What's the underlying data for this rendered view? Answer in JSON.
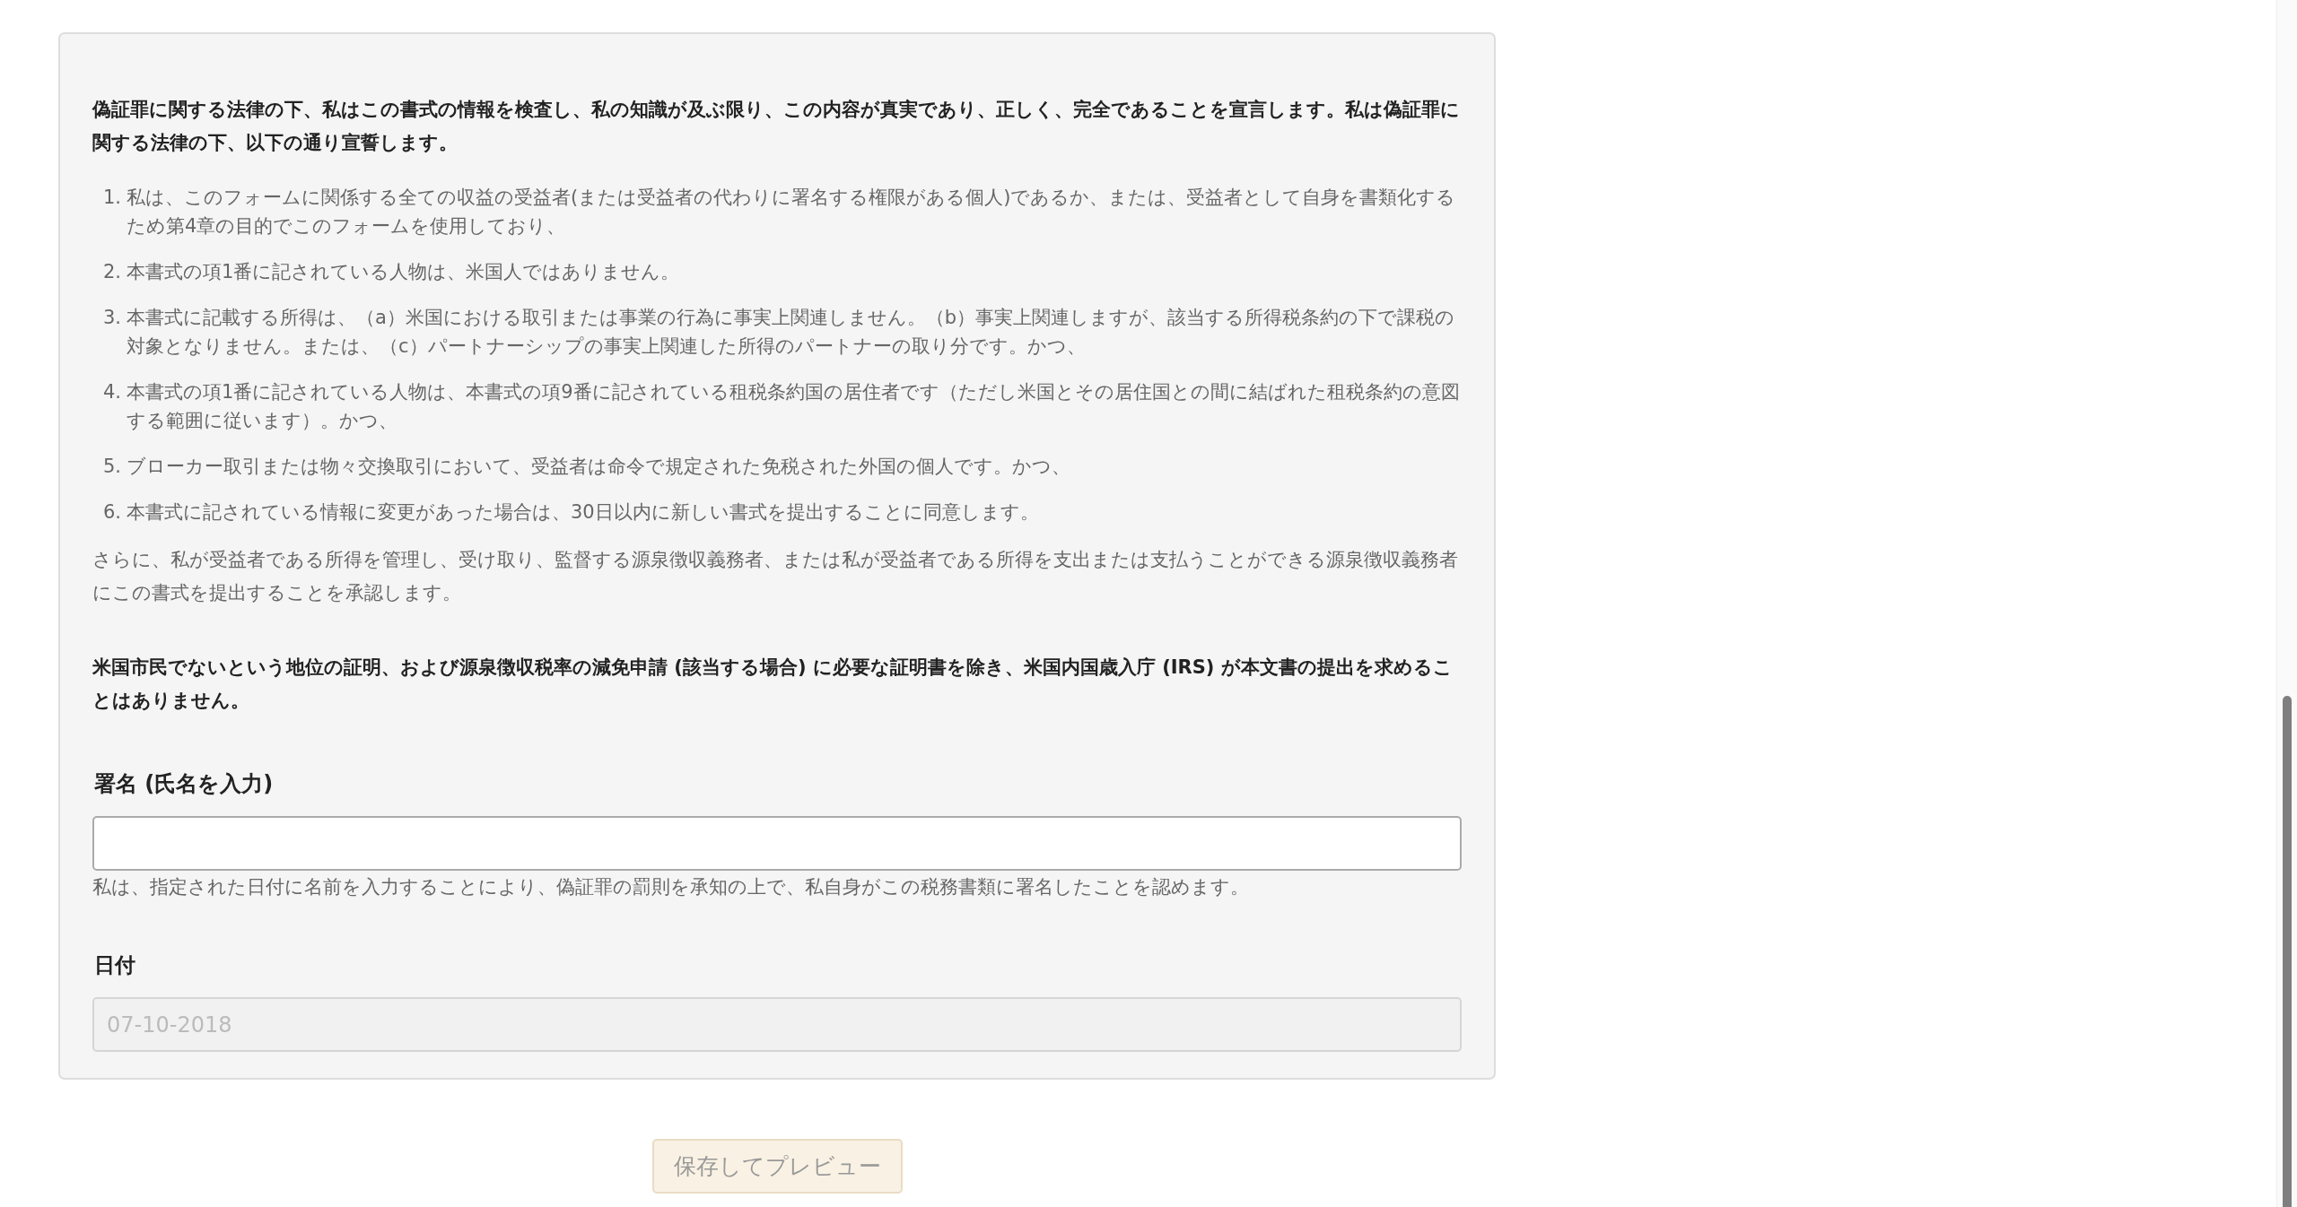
{
  "declaration": {
    "intro": "偽証罪に関する法律の下、私はこの書式の情報を検査し、私の知識が及ぶ限り、この内容が真実であり、正しく、完全であることを宣言します。私は偽証罪に関する法律の下、以下の通り宣誓します。",
    "items": [
      {
        "number": "1.",
        "text": "私は、このフォームに関係する全ての収益の受益者(または受益者の代わりに署名する権限がある個人)であるか、または、受益者として自身を書類化するため第4章の目的でこのフォームを使用しており、"
      },
      {
        "number": "2.",
        "text": "本書式の項1番に記されている人物は、米国人ではありません。"
      },
      {
        "number": "3.",
        "text": "本書式に記載する所得は、（a）米国における取引または事業の行為に事実上関連しません。（b）事実上関連しますが、該当する所得税条約の下で課税の対象となりません。または、（c）パートナーシップの事実上関連した所得のパートナーの取り分です。かつ、"
      },
      {
        "number": "4.",
        "text": "本書式の項1番に記されている人物は、本書式の項9番に記されている租税条約国の居住者です（ただし米国とその居住国との間に結ばれた租税条約の意図する範囲に従います）。かつ、"
      },
      {
        "number": "5.",
        "text": "ブローカー取引または物々交換取引において、受益者は命令で規定された免税された外国の個人です。かつ、"
      },
      {
        "number": "6.",
        "text": "本書式に記されている情報に変更があった場合は、30日以内に新しい書式を提出することに同意します。"
      }
    ],
    "acknowledgement": "さらに、私が受益者である所得を管理し、受け取り、監督する源泉徴収義務者、または私が受益者である所得を支出または支払うことができる源泉徴収義務者にこの書式を提出することを承認します。",
    "irs_note": "米国市民でないという地位の証明、および源泉徴収税率の減免申請 (該当する場合) に必要な証明書を除き、米国内国歳入庁 (IRS) が本文書の提出を求めることはありません。"
  },
  "signature": {
    "label": "署名 (氏名を入力)",
    "help": "私は、指定された日付に名前を入力することにより、偽証罪の罰則を承知の上で、私自身がこの税務書類に署名したことを認めます。"
  },
  "date": {
    "label": "日付",
    "value": "07-10-2018",
    "disabled": true
  },
  "save_button": {
    "label": "保存してプレビュー",
    "disabled": true
  }
}
